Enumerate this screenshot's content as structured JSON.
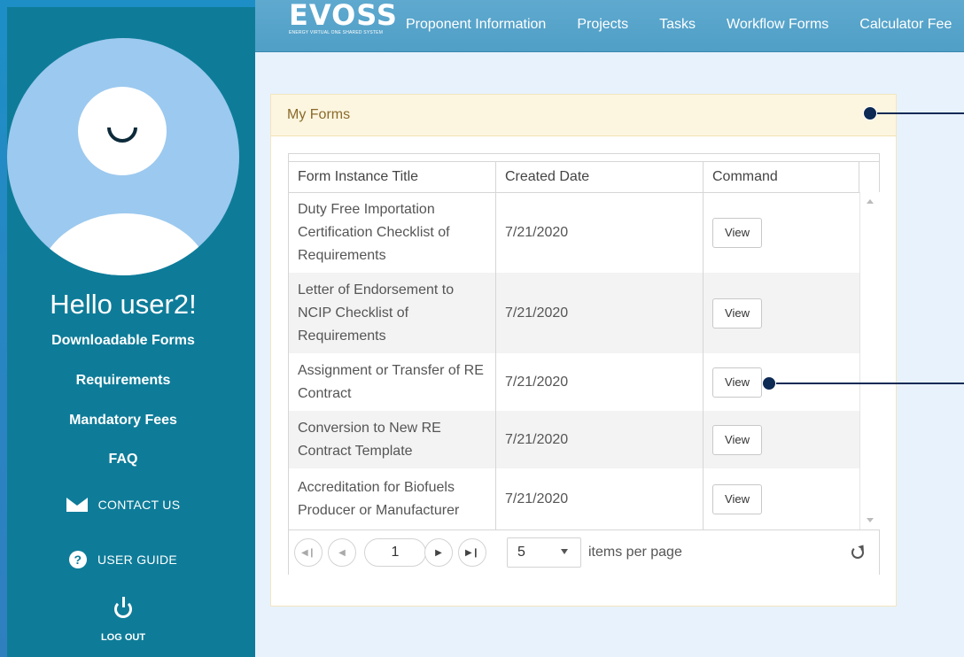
{
  "sidebar": {
    "greeting": "Hello user2!",
    "links": [
      {
        "label": "Downloadable Forms"
      },
      {
        "label": "Requirements"
      },
      {
        "label": "Mandatory Fees"
      },
      {
        "label": "FAQ"
      }
    ],
    "contact_label": "CONTACT US",
    "guide_label": "USER GUIDE",
    "logout_label": "LOG OUT"
  },
  "header": {
    "logo_text": "EVOSS",
    "logo_subtext": "ENERGY VIRTUAL ONE SHARED SYSTEM",
    "nav": [
      {
        "label": "Proponent Information"
      },
      {
        "label": "Projects"
      },
      {
        "label": "Tasks"
      },
      {
        "label": "Workflow Forms"
      },
      {
        "label": "Calculator Fee"
      }
    ]
  },
  "panel": {
    "title": "My Forms",
    "columns": [
      "Form Instance Title",
      "Created Date",
      "Command"
    ],
    "rows": [
      {
        "title": "Duty Free Importation Certification Checklist of Requirements",
        "date": "7/21/2020",
        "command": "View"
      },
      {
        "title": "Letter of Endorsement to NCIP Checklist of Requirements",
        "date": "7/21/2020",
        "command": "View"
      },
      {
        "title": "Assignment or Transfer of RE Contract",
        "date": "7/21/2020",
        "command": "View"
      },
      {
        "title": "Conversion to New RE Contract Template",
        "date": "7/21/2020",
        "command": "View"
      },
      {
        "title": "Accreditation for Biofuels Producer or Manufacturer",
        "date": "7/21/2020",
        "command": "View"
      }
    ],
    "pager": {
      "current_page": "1",
      "page_size": "5",
      "items_per_page_label": "items per page"
    }
  }
}
